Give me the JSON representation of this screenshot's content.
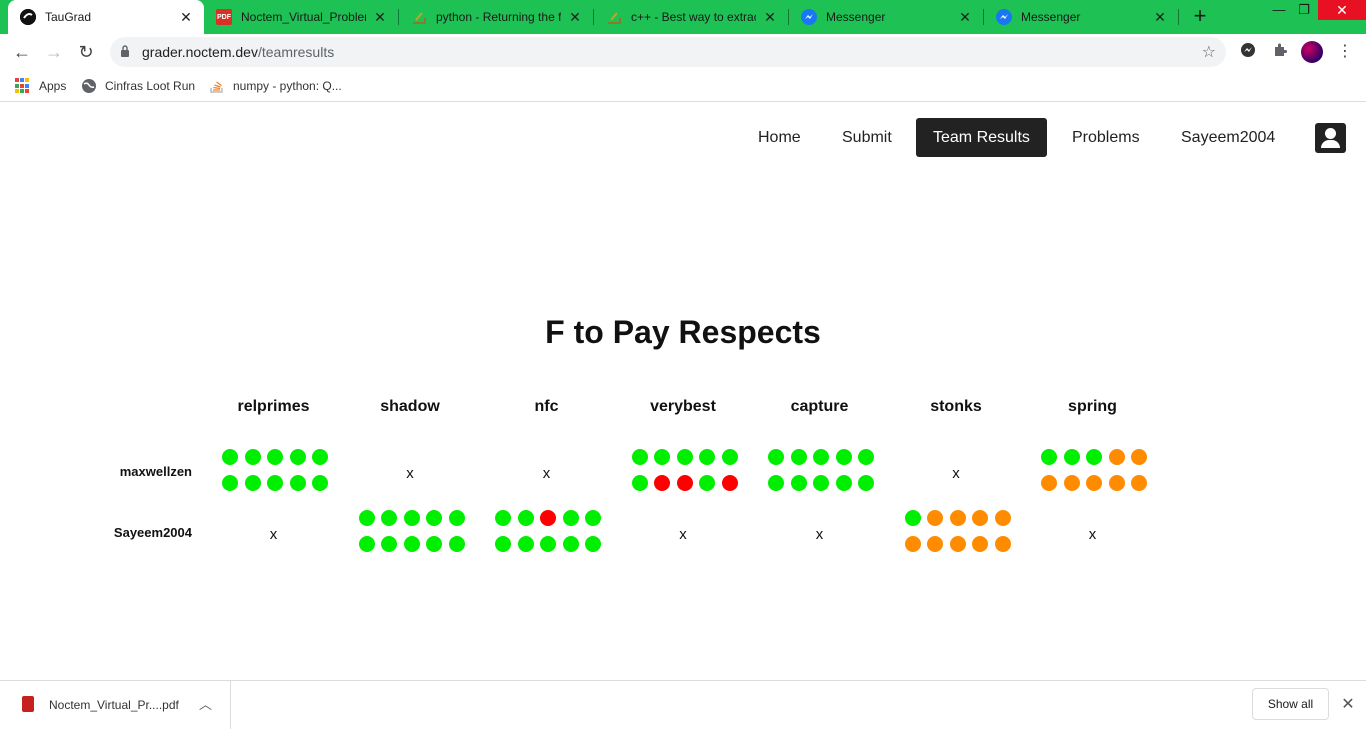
{
  "browser": {
    "tabs": [
      {
        "title": "TauGrad",
        "favicon": "taugrad-icon",
        "active": true
      },
      {
        "title": "Noctem_Virtual_Problems",
        "favicon": "pdf-icon",
        "active": false
      },
      {
        "title": "python - Returning the f",
        "favicon": "stack-exchange-icon",
        "active": false
      },
      {
        "title": "c++ - Best way to extract",
        "favicon": "stack-exchange-icon",
        "active": false
      },
      {
        "title": "Messenger",
        "favicon": "messenger-icon",
        "active": false
      },
      {
        "title": "Messenger",
        "favicon": "messenger-icon",
        "active": false
      }
    ],
    "url_host": "grader.noctem.dev",
    "url_path": "/teamresults",
    "bookmarks": [
      {
        "label": "Apps",
        "icon": "apps-grid-icon"
      },
      {
        "label": "Cinfras Loot Run",
        "icon": "globe-icon"
      },
      {
        "label": "numpy - python: Q...",
        "icon": "stack-overflow-icon"
      }
    ],
    "accent_color": "#1ec153"
  },
  "nav": {
    "home": "Home",
    "submit": "Submit",
    "team_results": "Team Results",
    "problems": "Problems",
    "user": "Sayeem2004"
  },
  "team": {
    "name": "F to Pay Respects"
  },
  "results": {
    "problems": [
      "relprimes",
      "shadow",
      "nfc",
      "verybest",
      "capture",
      "stonks",
      "spring"
    ],
    "legend_colors": {
      "g": "#00ee00",
      "r": "#ff0000",
      "o": "#ff8c00"
    },
    "empty_mark": "x",
    "members": [
      {
        "name": "maxwellzen",
        "cells": [
          [
            "g",
            "g",
            "g",
            "g",
            "g",
            "g",
            "g",
            "g",
            "g",
            "g"
          ],
          null,
          null,
          [
            "g",
            "g",
            "g",
            "g",
            "g",
            "g",
            "r",
            "r",
            "g",
            "r"
          ],
          [
            "g",
            "g",
            "g",
            "g",
            "g",
            "g",
            "g",
            "g",
            "g",
            "g"
          ],
          null,
          [
            "g",
            "g",
            "g",
            "o",
            "o",
            "o",
            "o",
            "o",
            "o",
            "o"
          ]
        ]
      },
      {
        "name": "Sayeem2004",
        "cells": [
          null,
          [
            "g",
            "g",
            "g",
            "g",
            "g",
            "g",
            "g",
            "g",
            "g",
            "g"
          ],
          [
            "g",
            "g",
            "r",
            "g",
            "g",
            "g",
            "g",
            "g",
            "g",
            "g"
          ],
          null,
          null,
          [
            "g",
            "o",
            "o",
            "o",
            "o",
            "o",
            "o",
            "o",
            "o",
            "o"
          ],
          null
        ]
      }
    ]
  },
  "downloads": {
    "file": "Noctem_Virtual_Pr....pdf",
    "show_all": "Show all"
  }
}
